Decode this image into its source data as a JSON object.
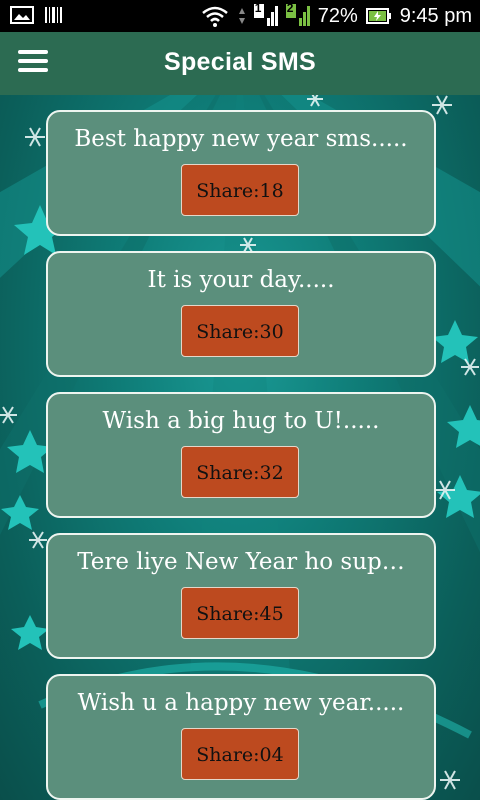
{
  "status_bar": {
    "battery": "72%",
    "time": "9:45 pm",
    "sim1_label": "1",
    "sim2_label": "2"
  },
  "app_bar": {
    "title": "Special SMS",
    "menu_icon": "hamburger-menu-icon"
  },
  "cards": [
    {
      "title": "Best happy new year sms.....",
      "share_label": "Share:18"
    },
    {
      "title": "It is your day.....",
      "share_label": "Share:30"
    },
    {
      "title": "Wish a big hug to U!.....",
      "share_label": "Share:32"
    },
    {
      "title": "Tere liye New Year ho sup…",
      "share_label": "Share:45"
    },
    {
      "title": "Wish u a happy new year.....",
      "share_label": "Share:04"
    }
  ],
  "colors": {
    "status_bar": "#000000",
    "app_bar": "#2c6b52",
    "card_fill": "#5b8f7c",
    "share_button": "#bd4a1f",
    "background": "#0f7d78"
  }
}
